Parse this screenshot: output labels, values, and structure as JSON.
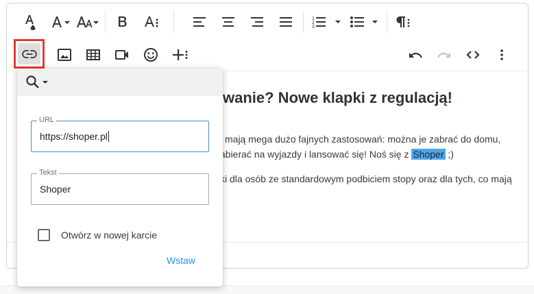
{
  "toolbar": {
    "row1": [
      "text-color",
      "font-size",
      "font-family",
      "bold",
      "more-text",
      "align-left",
      "align-center",
      "align-right",
      "align-justify",
      "ordered-list",
      "unordered-list",
      "paragraph-format"
    ],
    "row2": [
      "insert-link",
      "insert-image",
      "insert-table",
      "insert-video",
      "emoticons",
      "insert-more",
      "undo",
      "redo",
      "code-view",
      "more-misc"
    ]
  },
  "content": {
    "heading_visible": "wanie? Nowe klapki z regulacją!",
    "para1_line1": "i mają mega dużo fajnych zastosowań: można je zabrać do domu,",
    "para1_line2_before": "abierać na wyjazdy i lansować się! Noś się z ",
    "para1_highlight": "Shoper",
    "para1_line2_after": " ;)",
    "para2": "ki dla osób ze standardowym podbiciem stopy oraz dla tych, co mają"
  },
  "link_popup": {
    "url_label": "URL",
    "url_value": "https://shoper.pl",
    "text_label": "Tekst",
    "text_value": "Shoper",
    "new_tab_label": "Otwórz w nowej karcie",
    "new_tab_checked": false,
    "insert_label": "Wstaw"
  },
  "colors": {
    "highlight": "#4fa6e8",
    "insert_button": "#2196f3",
    "active_field_border": "#4a8fc9",
    "active_tool_outline": "#e53935"
  }
}
